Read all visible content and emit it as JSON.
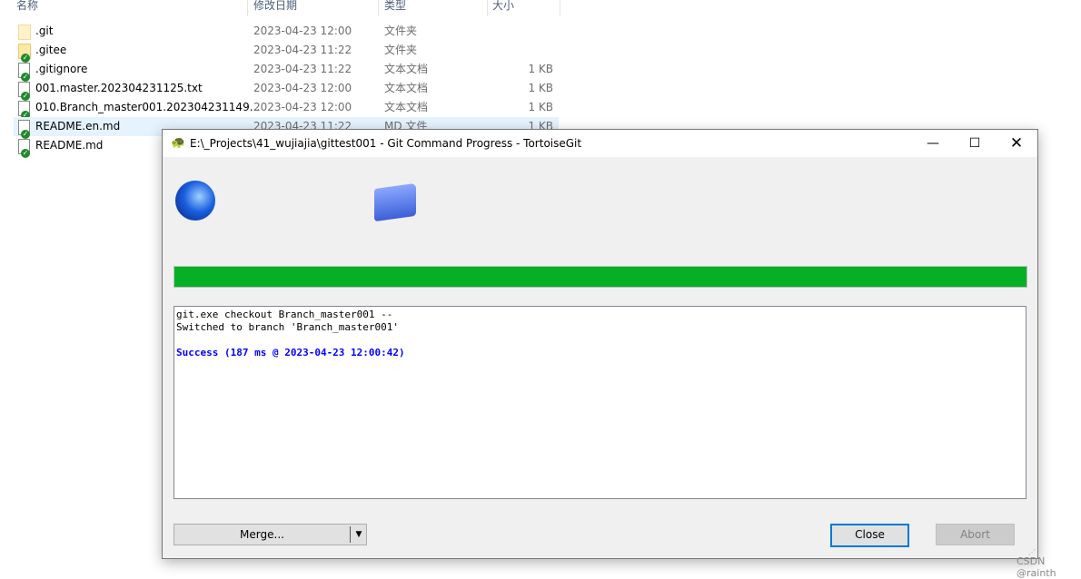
{
  "explorer": {
    "columns": [
      "名称",
      "修改日期",
      "类型",
      "大小"
    ],
    "rows": [
      {
        "name": ".git",
        "date": "2023-04-23 12:00",
        "type": "文件夹",
        "size": "",
        "icon": "folder-plain-icon"
      },
      {
        "name": ".gitee",
        "date": "2023-04-23 11:22",
        "type": "文件夹",
        "size": "",
        "icon": "folder-git-ok-icon"
      },
      {
        "name": ".gitignore",
        "date": "2023-04-23 11:22",
        "type": "文本文档",
        "size": "1 KB",
        "icon": "file-git-ok-icon"
      },
      {
        "name": "001.master.202304231125.txt",
        "date": "2023-04-23 12:00",
        "type": "文本文档",
        "size": "1 KB",
        "icon": "file-git-ok-icon"
      },
      {
        "name": "010.Branch_master001.202304231149...",
        "date": "2023-04-23 12:00",
        "type": "文本文档",
        "size": "1 KB",
        "icon": "file-git-ok-icon"
      },
      {
        "name": "README.en.md",
        "date": "2023-04-23 11:22",
        "type": "MD 文件",
        "size": "1 KB",
        "icon": "file-git-ok-icon",
        "selected": true
      },
      {
        "name": "README.md",
        "date": "",
        "type": "",
        "size": "",
        "icon": "file-git-ok-icon"
      }
    ]
  },
  "dialog": {
    "title": "E:\\_Projects\\41_wujiajia\\gittest001 - Git Command Progress - TortoiseGit",
    "progress_percent": 100,
    "progress_color": "#06b025",
    "log": [
      "git.exe checkout Branch_master001 --",
      "Switched to branch 'Branch_master001'",
      "",
      "Success (187 ms @ 2023-04-23 12:00:42)"
    ],
    "merge_label": "Merge...",
    "close_label": "Close",
    "abort_label": "Abort"
  },
  "watermark": "CSDN @rainth"
}
